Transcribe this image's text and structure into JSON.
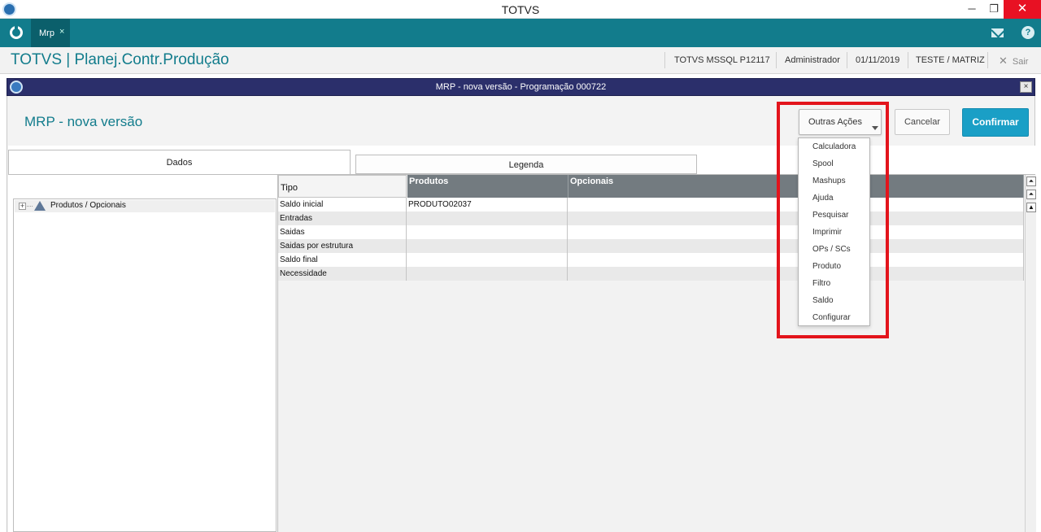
{
  "window": {
    "title": "TOTVS",
    "minimize_glyph": "─",
    "maximize_glyph": "❐",
    "close_glyph": "✕"
  },
  "tabbar": {
    "tabs": [
      {
        "label": "Mrp",
        "close_glyph": "×"
      }
    ],
    "icons": [
      "totvs-home-icon",
      "mail-icon",
      "help-icon"
    ],
    "help_glyph": "?"
  },
  "header": {
    "module_title": "TOTVS | Planej.Contr.Produção",
    "environment": "TOTVS  MSSQL P12117",
    "user": "Administrador",
    "date": "01/11/2019",
    "company": "TESTE / MATRIZ",
    "exit_label": "Sair",
    "exit_glyph": "✕"
  },
  "dialog": {
    "title": "MRP - nova versão - Programação 000722",
    "close_glyph": "×",
    "form_title": "MRP - nova versão",
    "buttons": {
      "other_actions": "Outras Ações",
      "cancel": "Cancelar",
      "confirm": "Confirmar"
    }
  },
  "folders": [
    {
      "label": "Dados"
    },
    {
      "label": "Legenda"
    }
  ],
  "tree": {
    "root_label": "Produtos / Opcionais",
    "expander_glyph": "+"
  },
  "grid": {
    "headers": {
      "tipo": "Tipo",
      "produtos": "Produtos",
      "opcionais": "Opcionais"
    },
    "rows": [
      {
        "tipo": "Saldo inicial",
        "produtos": "PRODUTO02037",
        "opcionais": ""
      },
      {
        "tipo": "Entradas",
        "produtos": "",
        "opcionais": ""
      },
      {
        "tipo": "Saidas",
        "produtos": "",
        "opcionais": ""
      },
      {
        "tipo": "Saidas por estrutura",
        "produtos": "",
        "opcionais": ""
      },
      {
        "tipo": "Saldo final",
        "produtos": "",
        "opcionais": ""
      },
      {
        "tipo": "Necessidade",
        "produtos": "",
        "opcionais": ""
      }
    ],
    "selected_row": 0,
    "scroll_glyphs": [
      "⏶",
      "⏶",
      "▲"
    ]
  },
  "menu": {
    "items": [
      "Calculadora",
      "Spool",
      "Mashups",
      "Ajuda",
      "Pesquisar",
      "Imprimir",
      "OPs / SCs",
      "Produto",
      "Filtro",
      "Saldo",
      "Configurar"
    ]
  },
  "colors": {
    "accent": "#127c8c",
    "confirm": "#1a9fc6",
    "dialog_bar": "#2b2f6b",
    "highlight": "#e3141c"
  }
}
